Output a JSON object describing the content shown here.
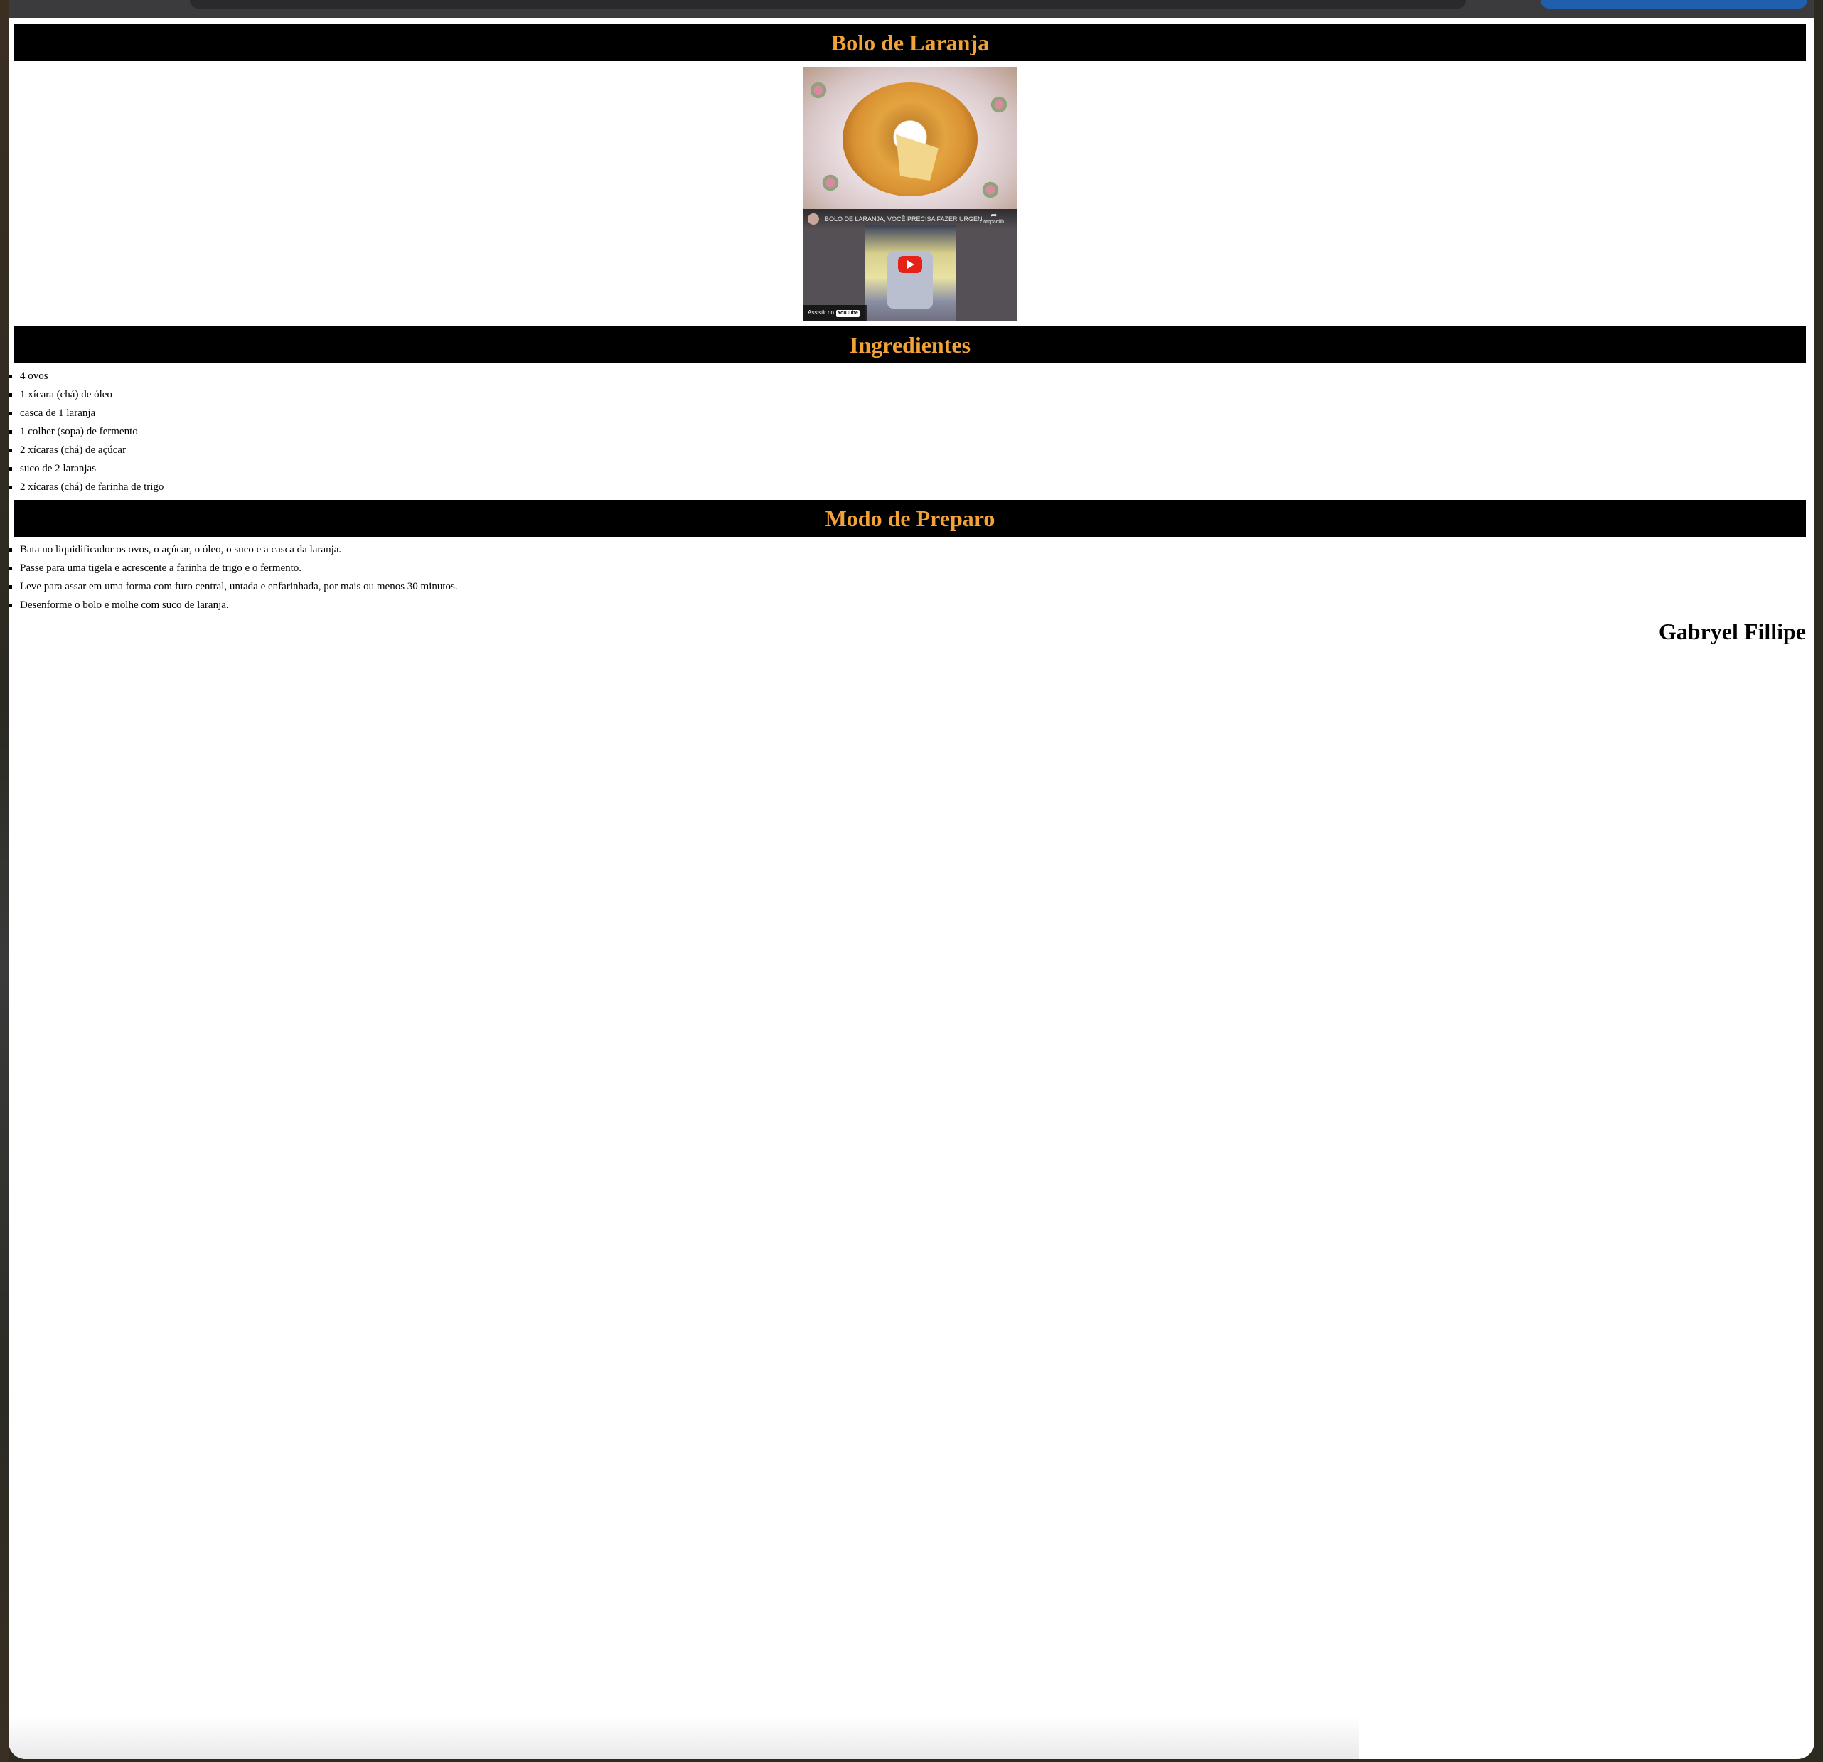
{
  "page": {
    "title": "Bolo de Laranja",
    "ingredients_heading": "Ingredientes",
    "preparation_heading": "Modo de Preparo",
    "author": "Gabryel Fillipe"
  },
  "video": {
    "title": "BOLO DE LARANJA, VOCÊ PRECISA FAZER URGEN...",
    "share_label": "Compartilh...",
    "watch_on": "Assistir no",
    "platform": "YouTube"
  },
  "ingredients": [
    "4 ovos",
    "1 xícara (chá) de óleo",
    "casca de 1 laranja",
    "1 colher (sopa) de fermento",
    "2 xícaras (chá) de açúcar",
    "suco de 2 laranjas",
    "2 xícaras (chá) de farinha de trigo"
  ],
  "steps": [
    "Bata no liquidificador os ovos, o açúcar, o óleo, o suco e a casca da laranja.",
    "Passe para uma tigela e acrescente a farinha de trigo e o fermento.",
    "Leve para assar em uma forma com furo central, untada e enfarinhada, por mais ou menos 30 minutos.",
    "Desenforme o bolo e molhe com suco de laranja."
  ],
  "colors": {
    "heading_bg": "#000000",
    "heading_text": "#f3a23a"
  }
}
